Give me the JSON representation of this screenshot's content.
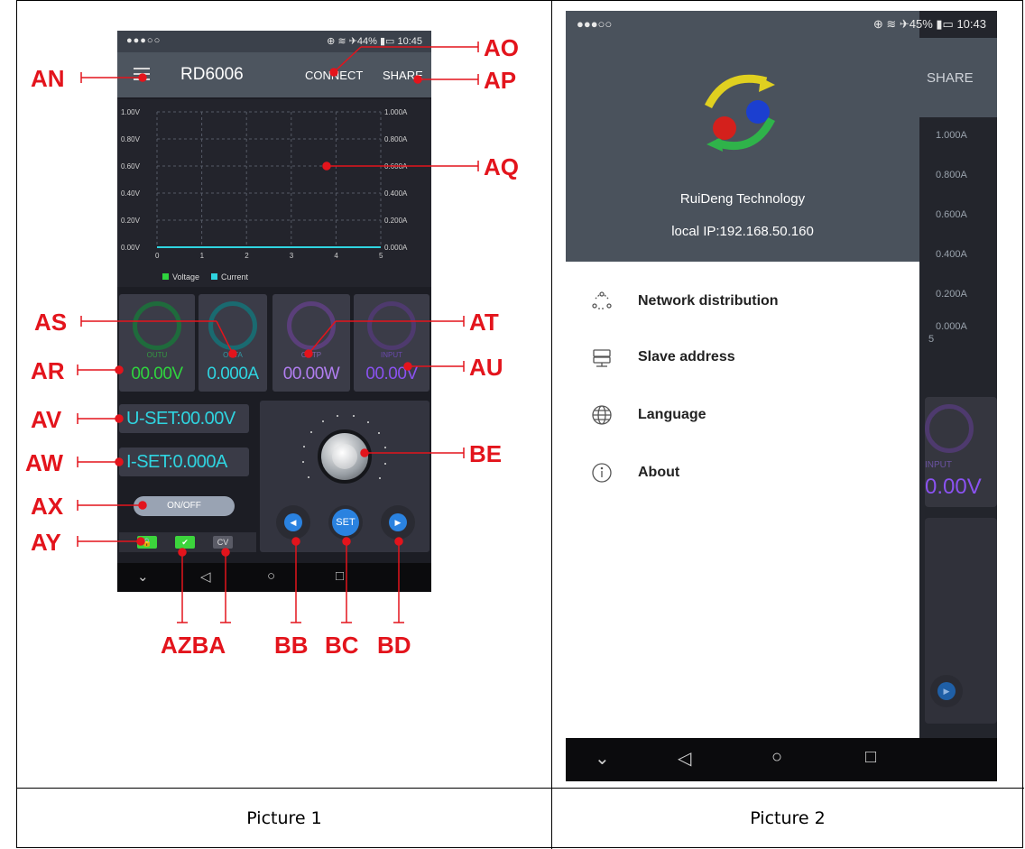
{
  "captions": {
    "left": "Picture 1",
    "right": "Picture 2"
  },
  "phone1": {
    "status_left": "●●●○○",
    "status_right": "⊕ ≋ ✈44% ▮▭ 10:45",
    "title": "RD6006",
    "connect_label": "CONNECT",
    "share_label": "SHARE",
    "chart": {
      "y_left_ticks": [
        "1.00V",
        "0.80V",
        "0.60V",
        "0.40V",
        "0.20V",
        "0.00V"
      ],
      "y_right_ticks": [
        "1.000A",
        "0.800A",
        "0.600A",
        "0.400A",
        "0.200A",
        "0.000A"
      ],
      "x_ticks": [
        "0",
        "1",
        "2",
        "3",
        "4",
        "5"
      ],
      "legend_voltage": "Voltage",
      "legend_current": "Current"
    },
    "tiles": [
      {
        "label": "OUTU",
        "value": "00.00V",
        "color": "#2fd43e"
      },
      {
        "label": "OUTA",
        "value": "0.000A",
        "color": "#2fd4e0"
      },
      {
        "label": "OUTP",
        "value": "00.00W",
        "color": "#b17ef0"
      },
      {
        "label": "INPUT",
        "value": "00.00V",
        "color": "#8a52f0"
      }
    ],
    "u_set": "U-SET:00.00V",
    "i_set": "I-SET:0.000A",
    "onoff_label": "ON/OFF",
    "cv_label": "CV",
    "set_label": "SET",
    "nav": {
      "down": "⌄",
      "back": "◁",
      "home": "○",
      "recent": "□"
    }
  },
  "callouts": {
    "AN": "AN",
    "AO": "AO",
    "AP": "AP",
    "AQ": "AQ",
    "AS": "AS",
    "AT": "AT",
    "AR": "AR",
    "AU": "AU",
    "AV": "AV",
    "AW": "AW",
    "AX": "AX",
    "AY": "AY",
    "BE": "BE",
    "AZBA": "AZBA",
    "BB": "BB",
    "BC": "BC",
    "BD": "BD"
  },
  "phone2": {
    "status_left": "●●●○○",
    "status_right": "⊕ ≋ ✈45% ▮▭ 10:43",
    "company": "RuiDeng Technology",
    "ip": "local IP:192.168.50.160",
    "menu": [
      {
        "label": "Network distribution",
        "icon": "network-icon"
      },
      {
        "label": "Slave address",
        "icon": "server-icon"
      },
      {
        "label": "Language",
        "icon": "globe-icon"
      },
      {
        "label": "About",
        "icon": "info-icon"
      }
    ],
    "bg_share": "SHARE",
    "bg_ticks": [
      "1.000A",
      "0.800A",
      "0.600A",
      "0.400A",
      "0.200A",
      "0.000A"
    ],
    "bg_x_tick": "5",
    "bg_input_label": "INPUT",
    "bg_input_value": "0.00V"
  }
}
